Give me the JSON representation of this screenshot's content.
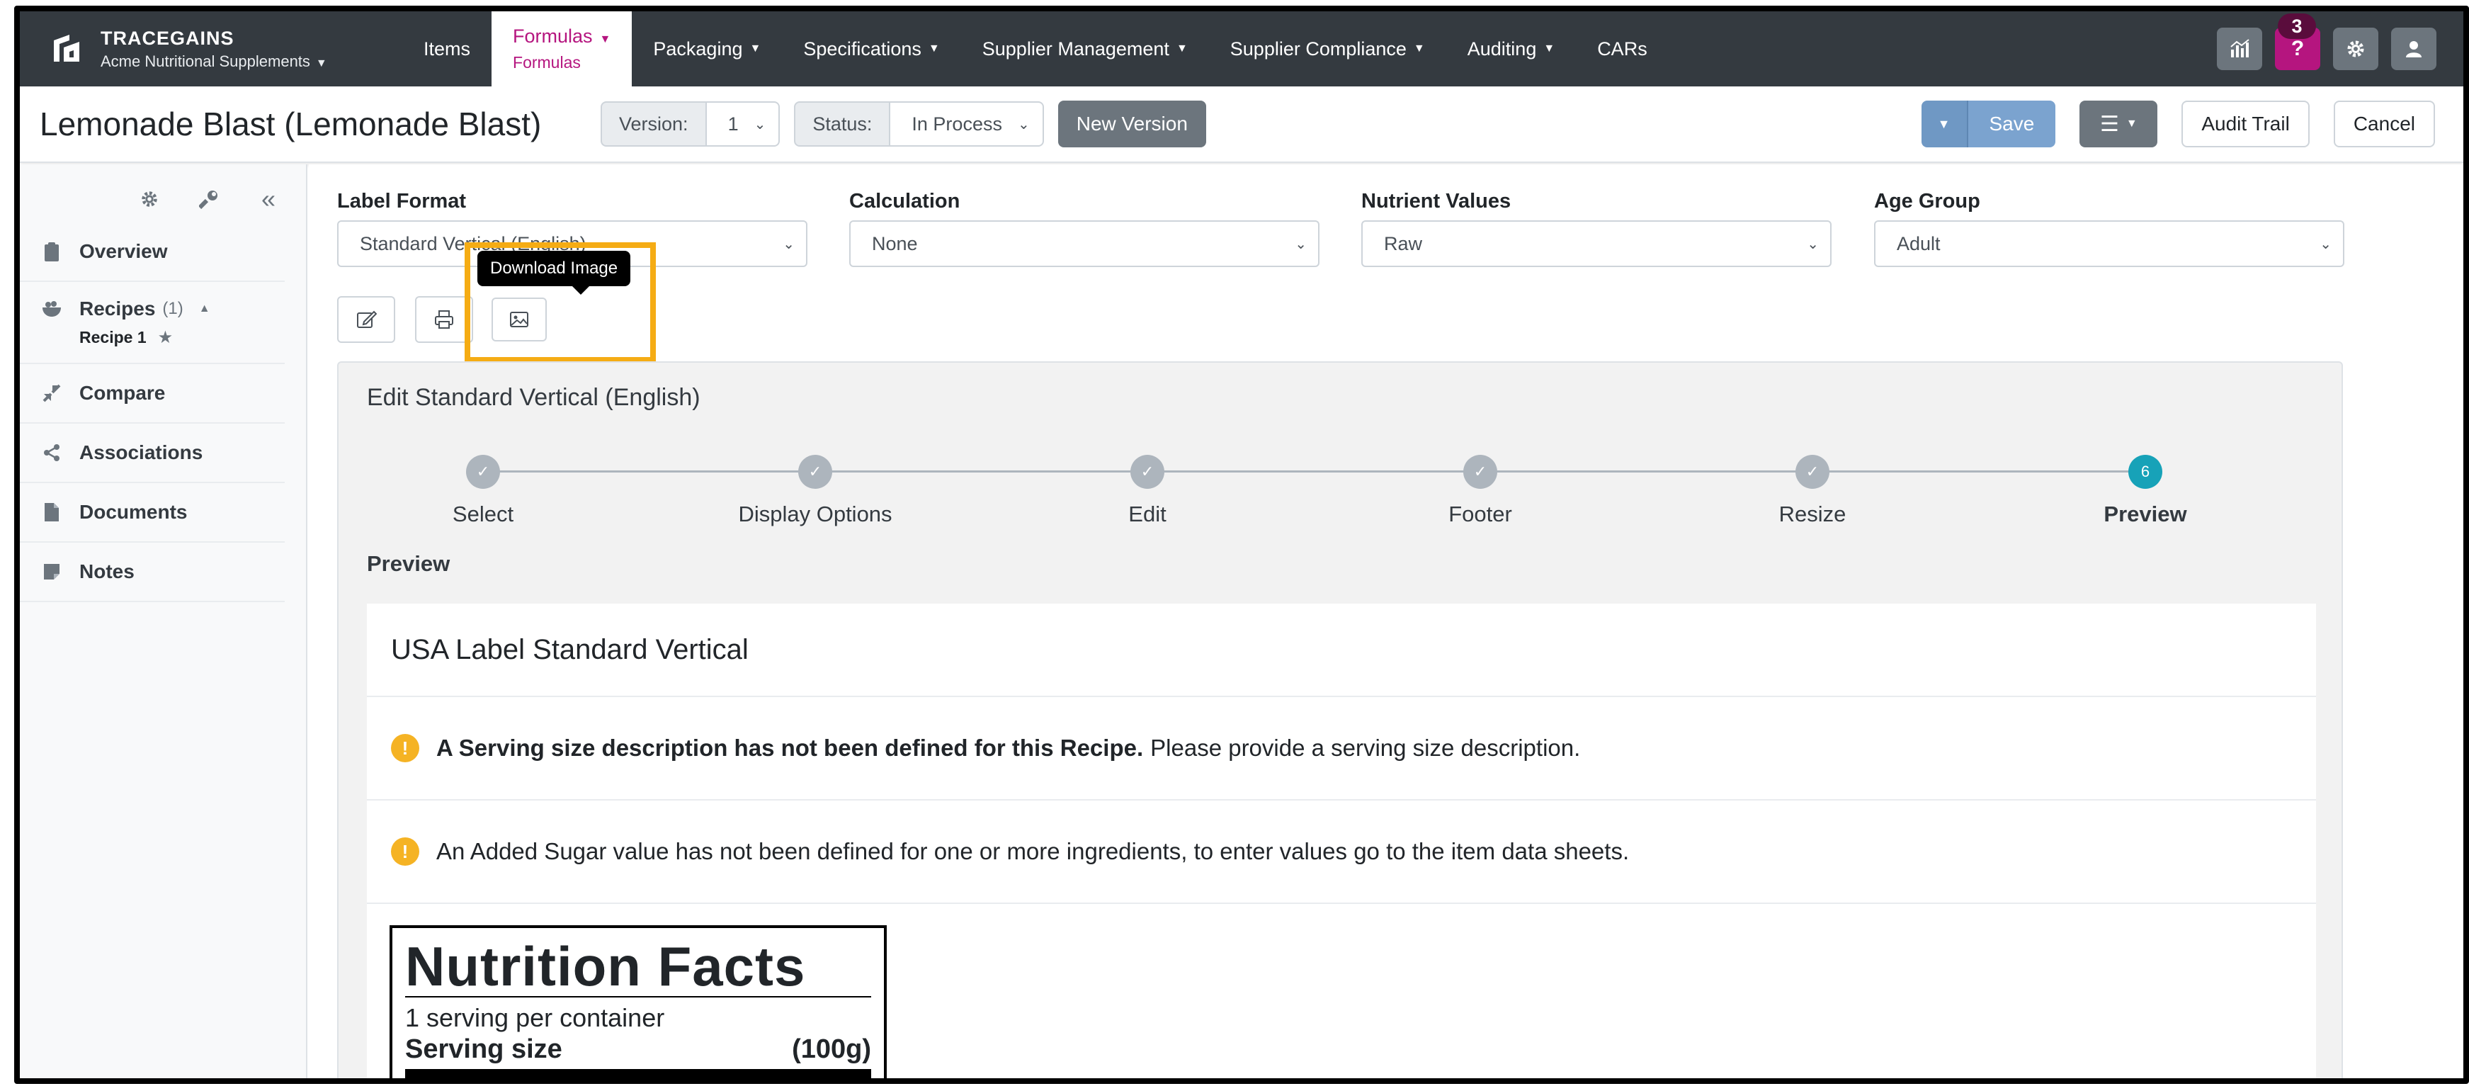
{
  "brand": {
    "name": "TRACEGAINS",
    "org": "Acme Nutritional Supplements"
  },
  "nav": {
    "items": [
      "Items",
      "Formulas",
      "Packaging",
      "Specifications",
      "Supplier Management",
      "Supplier Compliance",
      "Auditing",
      "CARs"
    ],
    "active_sub": "Formulas",
    "notification_count": "3",
    "help_label": "?"
  },
  "header": {
    "title": "Lemonade Blast (Lemonade Blast)",
    "version_label": "Version:",
    "version_value": "1",
    "status_label": "Status:",
    "status_value": "In Process",
    "new_version": "New Version",
    "save": "Save",
    "audit_trail": "Audit Trail",
    "cancel": "Cancel"
  },
  "sidebar": {
    "items": [
      {
        "label": "Overview"
      },
      {
        "label": "Recipes",
        "count": "(1)"
      },
      {
        "label": "Compare"
      },
      {
        "label": "Associations"
      },
      {
        "label": "Documents"
      },
      {
        "label": "Notes"
      }
    ],
    "recipe_sub": "Recipe 1"
  },
  "filters": {
    "label_format": {
      "label": "Label Format",
      "value": "Standard Vertical (English)"
    },
    "calculation": {
      "label": "Calculation",
      "value": "None"
    },
    "nutrient_values": {
      "label": "Nutrient Values",
      "value": "Raw"
    },
    "age_group": {
      "label": "Age Group",
      "value": "Adult"
    }
  },
  "tooltip": "Download Image",
  "panel": {
    "title": "Edit Standard Vertical (English)",
    "steps": [
      {
        "label": "Select",
        "done": true
      },
      {
        "label": "Display Options",
        "done": true
      },
      {
        "label": "Edit",
        "done": true
      },
      {
        "label": "Footer",
        "done": true
      },
      {
        "label": "Resize",
        "done": true
      },
      {
        "label": "Preview",
        "number": "6",
        "current": true
      }
    ],
    "preview_heading": "Preview",
    "card_title": "USA Label Standard Vertical",
    "warning1_bold": "A Serving size description has not been defined for this Recipe.",
    "warning1_rest": "Please provide a serving size description.",
    "warning2": "An Added Sugar value has not been defined for one or more ingredients, to enter values go to the item data sheets."
  },
  "nutrition": {
    "title": "Nutrition Facts",
    "servings": "1 serving per container",
    "serving_size_label": "Serving size",
    "serving_size_value": "(100g)"
  },
  "colors": {
    "navbar": "#343a40",
    "accent": "#b5157f",
    "highlight": "#f5ac14",
    "step_current": "#17a2b8"
  }
}
